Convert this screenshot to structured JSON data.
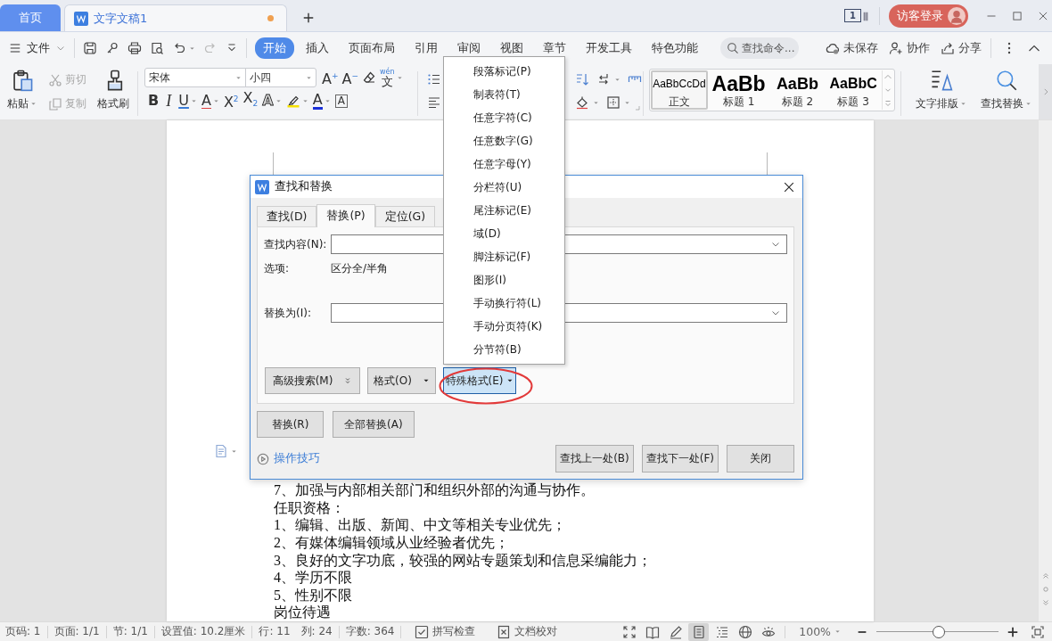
{
  "title_bar": {
    "tabs": [
      {
        "kind": "home",
        "label": "首页",
        "selected": false,
        "unsaved": false
      },
      {
        "kind": "document",
        "label": "文字文稿1",
        "selected": true,
        "unsaved": true
      }
    ],
    "window_count": "1",
    "account": "访客登录"
  },
  "menu_bar": {
    "file": "文件",
    "tabs": [
      {
        "label": "开始",
        "selected": true
      },
      {
        "label": "插入",
        "selected": false
      },
      {
        "label": "页面布局",
        "selected": false
      },
      {
        "label": "引用",
        "selected": false
      },
      {
        "label": "审阅",
        "selected": false
      },
      {
        "label": "视图",
        "selected": false
      },
      {
        "label": "章节",
        "selected": false
      },
      {
        "label": "开发工具",
        "selected": false
      },
      {
        "label": "特色功能",
        "selected": false
      }
    ],
    "search_placeholder": "查找命令...",
    "actions": [
      {
        "kind": "cloud",
        "label": "未保存"
      },
      {
        "kind": "collaborate",
        "label": "协作"
      },
      {
        "kind": "share",
        "label": "分享"
      }
    ]
  },
  "ribbon": {
    "clipboard": [
      {
        "kind": "paste",
        "label": "粘贴",
        "disabled": false
      },
      {
        "kind": "cut",
        "label": "剪切",
        "disabled": true
      },
      {
        "kind": "copy",
        "label": "复制",
        "disabled": true
      },
      {
        "kind": "painter",
        "label": "格式刷",
        "disabled": false
      }
    ],
    "font": {
      "name": "宋体",
      "size": "小四",
      "tools": [
        {
          "kind": "grow",
          "glyph": "A$^{+}$",
          "menu": false
        },
        {
          "kind": "shrink",
          "glyph": "A$^{−}$",
          "menu": false
        },
        {
          "kind": "clear",
          "menu": false
        },
        {
          "kind": "phonetic",
          "glyph": "文",
          "ruby": "wén",
          "menu": true
        }
      ],
      "formats": [
        {
          "kind": "bold",
          "glyph": "B",
          "menu": false
        },
        {
          "kind": "italic",
          "glyph": "I",
          "menu": false
        },
        {
          "kind": "underline",
          "glyph": "U",
          "menu": true
        },
        {
          "kind": "strike",
          "glyph": "A",
          "menu": true
        },
        {
          "kind": "superscript",
          "glyph": "X$^{2}$",
          "menu": false
        },
        {
          "kind": "subscript",
          "glyph": "X$_{2}$",
          "menu": false
        },
        {
          "kind": "effect",
          "glyph": "A",
          "menu": true
        },
        {
          "kind": "highlight",
          "menu": true
        },
        {
          "kind": "color",
          "glyph": "A",
          "menu": true
        },
        {
          "kind": "border",
          "glyph": "A",
          "menu": false
        }
      ]
    },
    "styles": [
      {
        "kind": "body",
        "sample": "AaBbCcDd",
        "label": "正文",
        "selected": true
      },
      {
        "kind": "heading1",
        "sample": "AaBb",
        "label": "标题 1",
        "selected": false
      },
      {
        "kind": "heading2",
        "sample": "AaBb",
        "label": "标题 2",
        "selected": false
      },
      {
        "kind": "heading3",
        "sample": "AaBbC",
        "label": "标题 3",
        "selected": false
      }
    ],
    "tools": [
      {
        "kind": "layout",
        "label": "文字排版"
      },
      {
        "kind": "find",
        "label": "查找替换"
      }
    ]
  },
  "document": {
    "lines": [
      "7、加强与内部相关部门和组织外部的沟通与协作。",
      "任职资格：",
      "1、编辑、出版、新闻、中文等相关专业优先；",
      "2、有媒体编辑领域从业经验者优先；",
      "3、良好的文字功底，较强的网站专题策划和信息采编能力；",
      "4、学历不限",
      "5、性别不限",
      "岗位待遇"
    ]
  },
  "dialog": {
    "title": "查找和替换",
    "tabs": [
      {
        "label": "查找(D)",
        "selected": false
      },
      {
        "label": "替换(P)",
        "selected": true
      },
      {
        "label": "定位(G)",
        "selected": false
      }
    ],
    "find_label": "查找内容(N):",
    "options_label": "选项:",
    "options_value": "区分全/半角",
    "replace_label": "替换为(I):",
    "option_buttons": [
      {
        "kind": "expand",
        "label": "高级搜索(M)",
        "selected": false,
        "circled": false
      },
      {
        "kind": "menu",
        "label": "格式(O)",
        "selected": false,
        "circled": false
      },
      {
        "kind": "menu",
        "label": "特殊格式(E)",
        "selected": true,
        "circled": true
      }
    ],
    "replace_buttons": [
      "替换(R)",
      "全部替换(A)"
    ],
    "tips_link": "操作技巧",
    "nav_buttons": [
      "查找上一处(B)",
      "查找下一处(F)",
      "关闭"
    ]
  },
  "special_format_menu": {
    "items": [
      "段落标记(P)",
      "制表符(T)",
      "任意字符(C)",
      "任意数字(G)",
      "任意字母(Y)",
      "分栏符(U)",
      "尾注标记(E)",
      "域(D)",
      "脚注标记(F)",
      "图形(I)",
      "手动换行符(L)",
      "手动分页符(K)",
      "分节符(B)"
    ]
  },
  "status_bar": {
    "groups": [
      [
        "页码: 1"
      ],
      [
        "页面: 1/1"
      ],
      [
        "节: 1/1"
      ],
      [
        "设置值: 10.2厘米"
      ],
      [
        "行: 11",
        "列: 24"
      ],
      [
        "字数: 364"
      ]
    ],
    "checks": [
      {
        "kind": "spell",
        "label": "拼写检查"
      },
      {
        "kind": "proof",
        "label": "文档校对"
      }
    ],
    "views": [
      {
        "kind": "fullscreen",
        "selected": false
      },
      {
        "kind": "reading",
        "selected": false
      },
      {
        "kind": "edit",
        "selected": false
      },
      {
        "kind": "page",
        "selected": true
      },
      {
        "kind": "outline",
        "selected": false
      },
      {
        "kind": "web",
        "selected": false
      },
      {
        "kind": "focus",
        "selected": false
      }
    ],
    "zoom": {
      "label": "100%",
      "level": 0.5
    }
  }
}
